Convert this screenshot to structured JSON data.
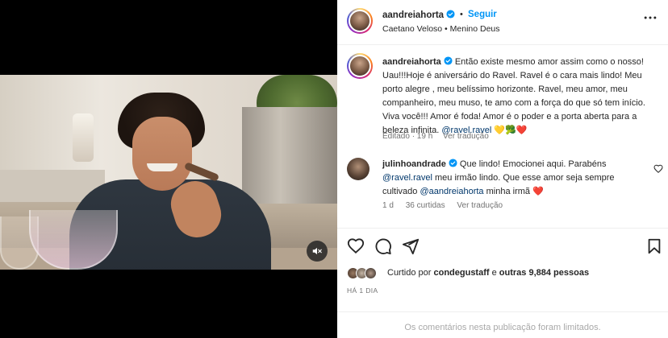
{
  "header": {
    "username": "aandreiahorta",
    "follow_label": "Seguir",
    "dot": "•",
    "music": "Caetano Veloso • Menino Deus",
    "more_icon": "more-horizontal-icon"
  },
  "caption": {
    "username": "aandreiahorta",
    "body": "Então existe mesmo amor assim como o nosso! Uau!!!Hoje é aniversário do Ravel. Ravel é o cara mais lindo! Meu porto alegre , meu belíssimo horizonte. Ravel, meu amor, meu companheiro, meu muso, te amo com a força do que só tem início. Viva você!!! Amor é foda! Amor é o poder e a porta aberta para a beleza infinita.",
    "mention": "@ravel.ravel",
    "emojis": "💛🥦❤️",
    "edited": "Editado · 19 h",
    "translate": "Ver tradução"
  },
  "comment": {
    "username": "julinhoandrade",
    "part1": "Que lindo! Emocionei aqui. Parabéns",
    "mention1": "@ravel.ravel",
    "part2": "meu irmão lindo. Que esse amor seja sempre cultivado",
    "mention2": "@aandreiahorta",
    "part3": "minha irmã",
    "emoji": "❤️",
    "time": "1 d",
    "likes": "36 curtidas",
    "translate": "Ver tradução"
  },
  "likes": {
    "prefix": "Curtido por",
    "user": "condegustaff",
    "middle": "e",
    "others": "outras 9,884 pessoas"
  },
  "date": "HÁ 1 DIA",
  "limited": "Os comentários nesta publicação foram limitados.",
  "colors": {
    "accent": "#0095f6",
    "verified": "#0095f6",
    "mention": "#00376b",
    "muted": "#737373"
  }
}
